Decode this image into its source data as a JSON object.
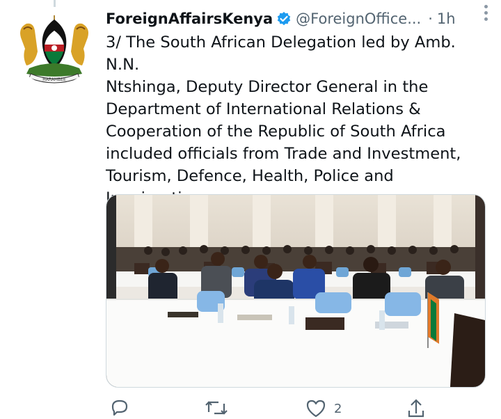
{
  "tweet": {
    "display_name": "ForeignAffairsKenya",
    "handle": "@ForeignOffice...",
    "separator": "·",
    "time": "1h",
    "verified": true,
    "text": "3/ The South African Delegation led by Amb. N.N.\nNtshinga, Deputy Director General in the\nDepartment of International Relations &\nCooperation of the Republic of South Africa\nincluded officials from Trade and Investment,\nTourism, Defence, Health, Police and Immigration\nDepartments",
    "media": {
      "icon": "photo-conference-delegation",
      "alt": ""
    }
  },
  "actions": {
    "reply_icon": "reply-icon",
    "retweet_icon": "retweet-icon",
    "like_icon": "like-icon",
    "like_count": "2",
    "share_icon": "share-icon"
  },
  "colors": {
    "text": "#0f1419",
    "muted": "#536471",
    "verified": "#1d9bf0",
    "border": "#cfd9de"
  }
}
